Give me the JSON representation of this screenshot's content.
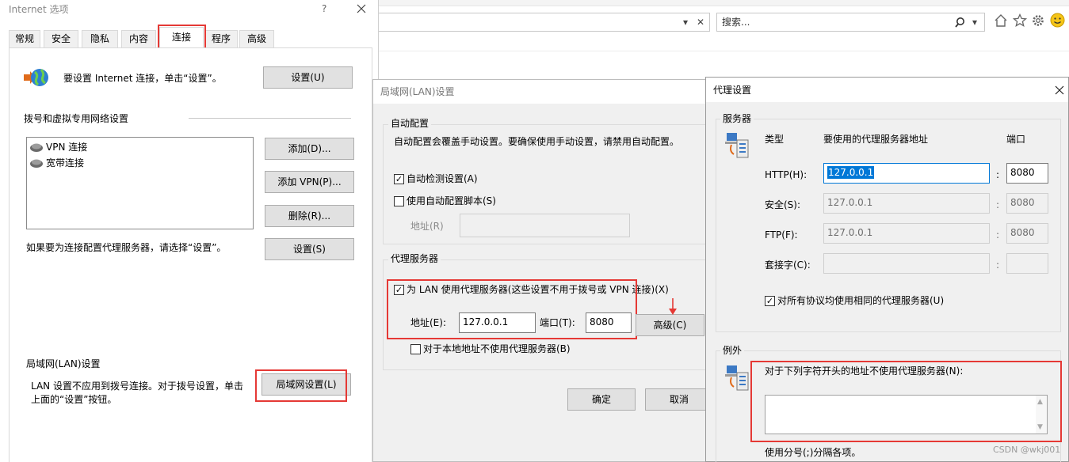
{
  "browser": {
    "search_placeholder": "搜索...",
    "dropdown_glyph": "▾",
    "close_glyph": "✕",
    "home_icon": "home-icon",
    "star_icon": "star-icon",
    "gear_icon": "gear-icon",
    "smiley_icon": "smiley-icon"
  },
  "internet_options": {
    "title": "Internet 选项",
    "help": "?",
    "tabs": [
      "常规",
      "安全",
      "隐私",
      "内容",
      "连接",
      "程序",
      "高级"
    ],
    "active_tab": "连接",
    "setup_text": "要设置 Internet 连接，单击“设置”。",
    "setup_button": "设置(U)",
    "dialup_heading": "拨号和虚拟专用网络设置",
    "connections": [
      "VPN 连接",
      "宽带连接"
    ],
    "add_button": "添加(D)...",
    "add_vpn_button": "添加 VPN(P)...",
    "delete_button": "删除(R)...",
    "proxy_text": "如果要为连接配置代理服务器，请选择“设置”。",
    "settings_button": "设置(S)",
    "lan_heading": "局域网(LAN)设置",
    "lan_text_1": "LAN 设置不应用到拨号连接。对于拨号设置，单击",
    "lan_text_2": "上面的“设置”按钮。",
    "lan_button": "局域网设置(L)"
  },
  "lan_dialog": {
    "title": "局域网(LAN)设置",
    "auto_config_group": "自动配置",
    "auto_config_text": "自动配置会覆盖手动设置。要确保使用手动设置，请禁用自动配置。",
    "auto_detect_label": "自动检测设置(A)",
    "auto_detect_checked": true,
    "auto_script_label": "使用自动配置脚本(S)",
    "auto_script_checked": false,
    "address_label_disabled": "地址(R)",
    "proxy_group": "代理服务器",
    "use_proxy_label": "为 LAN 使用代理服务器(这些设置不用于拨号或 VPN 连接)(X)",
    "use_proxy_checked": true,
    "address_label": "地址(E):",
    "address_value": "127.0.0.1",
    "port_label": "端口(T):",
    "port_value": "8080",
    "advanced_button": "高级(C)",
    "bypass_local_label": "对于本地地址不使用代理服务器(B)",
    "bypass_local_checked": false,
    "ok_button": "确定",
    "cancel_button": "取消"
  },
  "proxy_settings": {
    "title": "代理设置",
    "servers_group": "服务器",
    "col_type": "类型",
    "col_address": "要使用的代理服务器地址",
    "col_port": "端口",
    "rows": [
      {
        "label": "HTTP(H):",
        "address": "127.0.0.1",
        "port": "8080"
      },
      {
        "label": "安全(S):",
        "address": "127.0.0.1",
        "port": "8080"
      },
      {
        "label": "FTP(F):",
        "address": "127.0.0.1",
        "port": "8080"
      },
      {
        "label": "套接字(C):",
        "address": "",
        "port": ""
      }
    ],
    "colon": ":",
    "same_proxy_label": "对所有协议均使用相同的代理服务器(U)",
    "same_proxy_checked": true,
    "exceptions_group": "例外",
    "exceptions_text": "对于下列字符开头的地址不使用代理服务器(N):",
    "exceptions_value": "",
    "separator_note": "使用分号(;)分隔各项。"
  },
  "watermark": "CSDN @wkj001",
  "colors": {
    "highlight_red": "#e53935",
    "dialog_bg": "#f0f0f0",
    "selection_blue": "#0078d7"
  }
}
